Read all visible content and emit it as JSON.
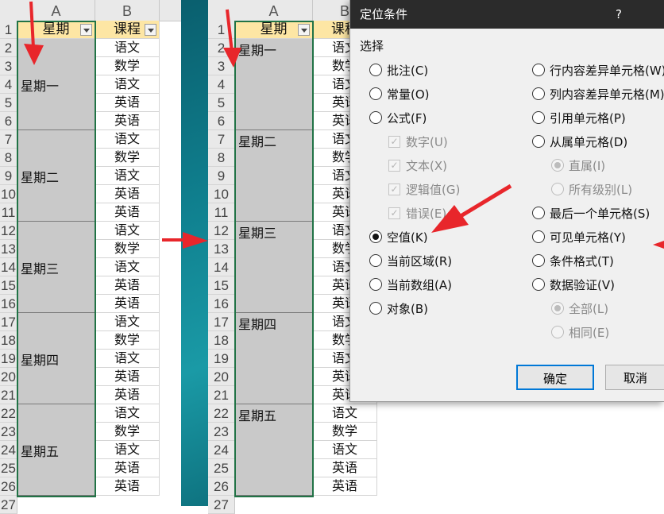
{
  "col_headers": [
    "A",
    "B"
  ],
  "filter_headers": [
    "星期",
    "课程"
  ],
  "row_numbers": [
    "1",
    "2",
    "3",
    "4",
    "5",
    "6",
    "7",
    "8",
    "9",
    "10",
    "11",
    "12",
    "13",
    "14",
    "15",
    "16",
    "17",
    "18",
    "19",
    "20",
    "21",
    "22",
    "23",
    "24",
    "25",
    "26"
  ],
  "row_27_partial": "27",
  "days": [
    "星期一",
    "星期二",
    "星期三",
    "星期四",
    "星期五"
  ],
  "courses": [
    "语文",
    "数学",
    "语文",
    "英语",
    "英语",
    "语文",
    "数学",
    "语文",
    "英语",
    "英语",
    "语文",
    "数学",
    "语文",
    "英语",
    "英语",
    "语文",
    "数学",
    "语文",
    "英语",
    "英语",
    "语文",
    "数学",
    "语文",
    "英语",
    "英语"
  ],
  "dialog": {
    "title": "定位条件",
    "help": "?",
    "group_label": "选择",
    "left_options": [
      {
        "label": "批注(C)",
        "type": "radio",
        "checked": false,
        "disabled": false
      },
      {
        "label": "常量(O)",
        "type": "radio",
        "checked": false,
        "disabled": false
      },
      {
        "label": "公式(F)",
        "type": "radio",
        "checked": false,
        "disabled": false
      },
      {
        "label": "数字(U)",
        "type": "checkbox",
        "checked": true,
        "disabled": true
      },
      {
        "label": "文本(X)",
        "type": "checkbox",
        "checked": true,
        "disabled": true
      },
      {
        "label": "逻辑值(G)",
        "type": "checkbox",
        "checked": true,
        "disabled": true
      },
      {
        "label": "错误(E)",
        "type": "checkbox",
        "checked": true,
        "disabled": true
      },
      {
        "label": "空值(K)",
        "type": "radio",
        "checked": true,
        "disabled": false
      },
      {
        "label": "当前区域(R)",
        "type": "radio",
        "checked": false,
        "disabled": false
      },
      {
        "label": "当前数组(A)",
        "type": "radio",
        "checked": false,
        "disabled": false
      },
      {
        "label": "对象(B)",
        "type": "radio",
        "checked": false,
        "disabled": false
      }
    ],
    "right_options": [
      {
        "label": "行内容差异单元格(W)",
        "type": "radio",
        "checked": false,
        "disabled": false
      },
      {
        "label": "列内容差异单元格(M)",
        "type": "radio",
        "checked": false,
        "disabled": false
      },
      {
        "label": "引用单元格(P)",
        "type": "radio",
        "checked": false,
        "disabled": false
      },
      {
        "label": "从属单元格(D)",
        "type": "radio",
        "checked": false,
        "disabled": false
      },
      {
        "label": "直属(I)",
        "type": "radio",
        "checked": true,
        "disabled": true
      },
      {
        "label": "所有级别(L)",
        "type": "radio",
        "checked": false,
        "disabled": true
      },
      {
        "label": "最后一个单元格(S)",
        "type": "radio",
        "checked": false,
        "disabled": false
      },
      {
        "label": "可见单元格(Y)",
        "type": "radio",
        "checked": false,
        "disabled": false
      },
      {
        "label": "条件格式(T)",
        "type": "radio",
        "checked": false,
        "disabled": false
      },
      {
        "label": "数据验证(V)",
        "type": "radio",
        "checked": false,
        "disabled": false
      },
      {
        "label": "全部(L)",
        "type": "radio",
        "checked": true,
        "disabled": true
      },
      {
        "label": "相同(E)",
        "type": "radio",
        "checked": false,
        "disabled": true
      }
    ],
    "ok_label": "确定",
    "cancel_label": "取消"
  },
  "colors": {
    "header_fill": "#fde6a4",
    "merged_fill": "#c9c9c9",
    "selection_border": "#217346",
    "arrow": "#e8262b",
    "dialog_title_bar": "#2b2b2b",
    "primary_button_border": "#0078d7"
  }
}
